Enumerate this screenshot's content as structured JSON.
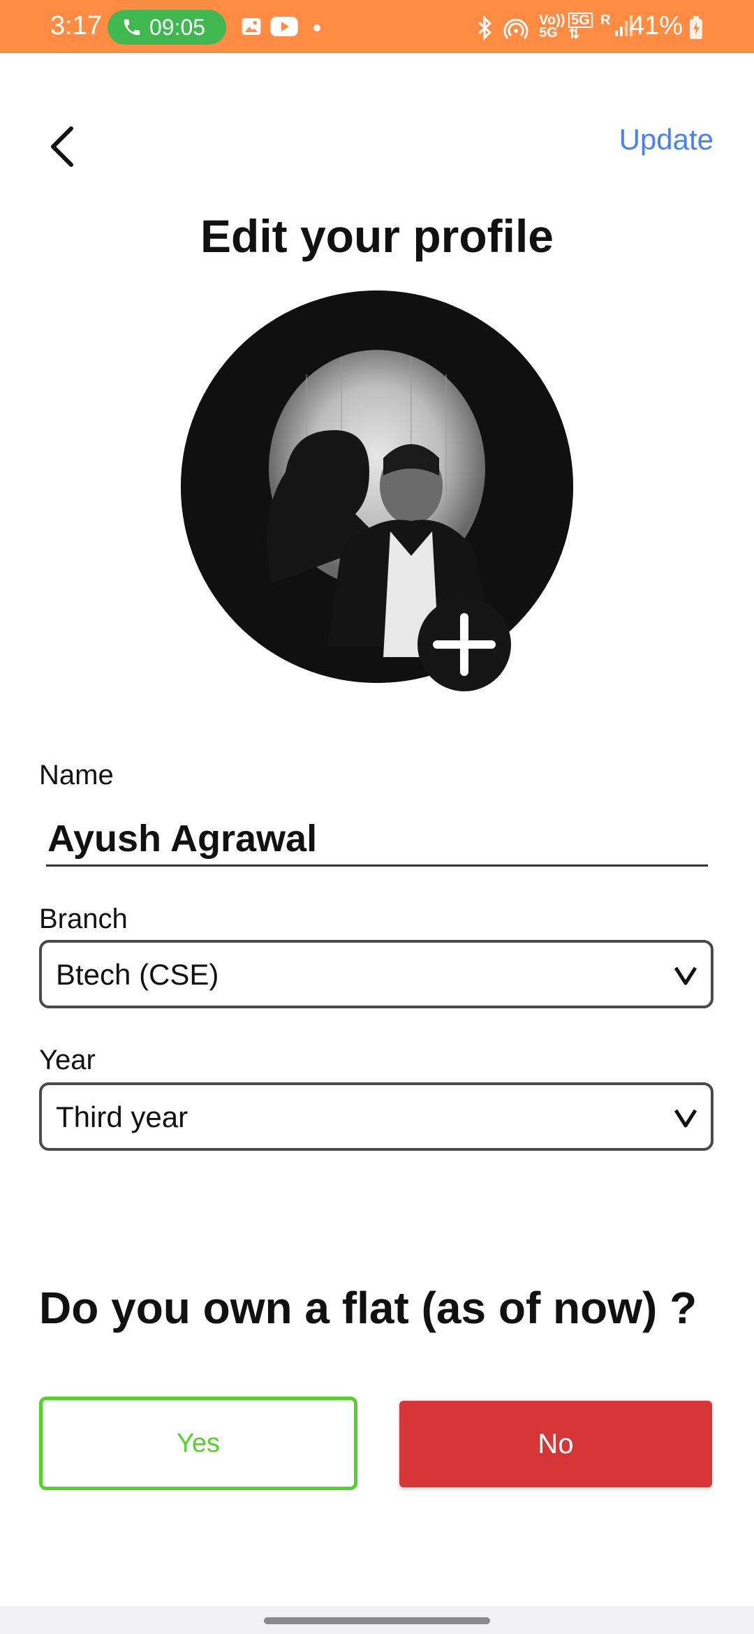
{
  "status_bar": {
    "time": "3:17",
    "call_timer": "09:05",
    "battery": "41%",
    "signal_labels": [
      "Vo))",
      "5G",
      "5G",
      "R"
    ],
    "icons": [
      "phone-icon",
      "gallery-icon",
      "youtube-icon",
      "dot-icon",
      "bluetooth-icon",
      "hotspot-icon",
      "volte-icon",
      "data-arrows-icon",
      "signal-icon",
      "battery-icon"
    ]
  },
  "header": {
    "back_icon": "chevron-left-icon",
    "update_label": "Update"
  },
  "title": "Edit your profile",
  "avatar": {
    "icon": "profile-photo",
    "add_icon": "plus-icon"
  },
  "form": {
    "name_label": "Name",
    "name_value": "Ayush Agrawal",
    "branch_label": "Branch",
    "branch_value": "Btech (CSE)",
    "year_label": "Year",
    "year_value": "Third year"
  },
  "question": "Do you own a flat (as of now) ?",
  "choices": {
    "yes_label": "Yes",
    "no_label": "No"
  },
  "colors": {
    "status_bar": "#FF8C42",
    "accent_link": "#4A80F0",
    "yes_border": "#52D22A",
    "no_fill": "#D63636",
    "call_pill": "#3FB84F"
  }
}
